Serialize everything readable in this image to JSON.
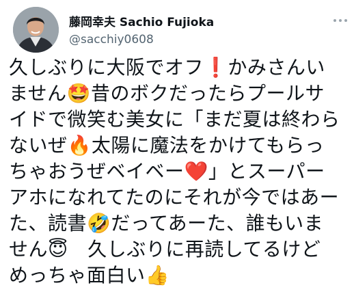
{
  "author": {
    "display_name": "藤岡幸夫 Sachio Fujioka",
    "handle": "@sacchiy0608",
    "avatar_icon": "profile-photo"
  },
  "more_icon": "more-options-icon",
  "tweet": {
    "lines": [
      "久しぶりに大阪でオフ❗️かみさんい",
      "ません🤩昔のボクだったらプールサ",
      "イドで微笑む美女に「まだ夏は終わら",
      "ないぜ🔥太陽に魔法をかけてもらっ",
      "ちゃおうぜベイベー❤️」とスーパー",
      "アホになれてたのにそれが今ではあー",
      "た、読書🤣だってあーた、誰もいま",
      "せん😇　久しぶりに再読してるけど",
      "めっちゃ面白い👍"
    ]
  }
}
